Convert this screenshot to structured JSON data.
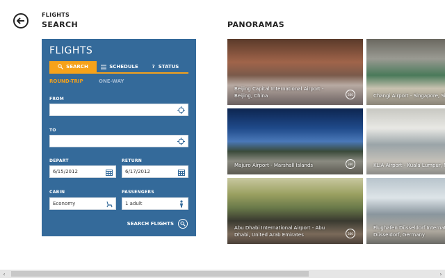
{
  "header": {
    "breadcrumb": "FLIGHTS",
    "title": "SEARCH",
    "panoramas_title": "PANORAMAS"
  },
  "panel": {
    "title": "FLIGHTS",
    "tabs": [
      {
        "label": "SEARCH",
        "active": true
      },
      {
        "label": "SCHEDULE",
        "active": false
      },
      {
        "label": "STATUS",
        "active": false
      }
    ],
    "trip_modes": [
      "ROUND-TRIP",
      "ONE-WAY"
    ],
    "from": {
      "label": "FROM",
      "value": ""
    },
    "to": {
      "label": "TO",
      "value": ""
    },
    "depart": {
      "label": "DEPART",
      "value": "6/15/2012"
    },
    "return": {
      "label": "RETURN",
      "value": "6/17/2012"
    },
    "cabin": {
      "label": "CABIN",
      "value": "Economy"
    },
    "passengers": {
      "label": "PASSENGERS",
      "value": "1 adult"
    },
    "search_label": "SEARCH FLIGHTS",
    "accent_color": "#f6a21a",
    "panel_color": "#346a9a"
  },
  "panoramas": [
    {
      "line1": "Beijing Capital International Airport -",
      "line2": "Beijing, China",
      "badge": "360"
    },
    {
      "line1": "Changi Airport - Singapore, Singa",
      "line2": "",
      "badge": "360"
    },
    {
      "line1": "Majuro Airport - Marshall Islands",
      "line2": "",
      "badge": "360"
    },
    {
      "line1": "KLIA Airport - Kuala Lumpur, Ma",
      "line2": "",
      "badge": "360"
    },
    {
      "line1": "Abu Dhabi International Airport - Abu",
      "line2": "Dhabi, United Arab Emirates",
      "badge": "360"
    },
    {
      "line1": "Flughafen Düsseldorf Internat",
      "line2": "Düsseldorf, Germany",
      "badge": "360"
    }
  ]
}
